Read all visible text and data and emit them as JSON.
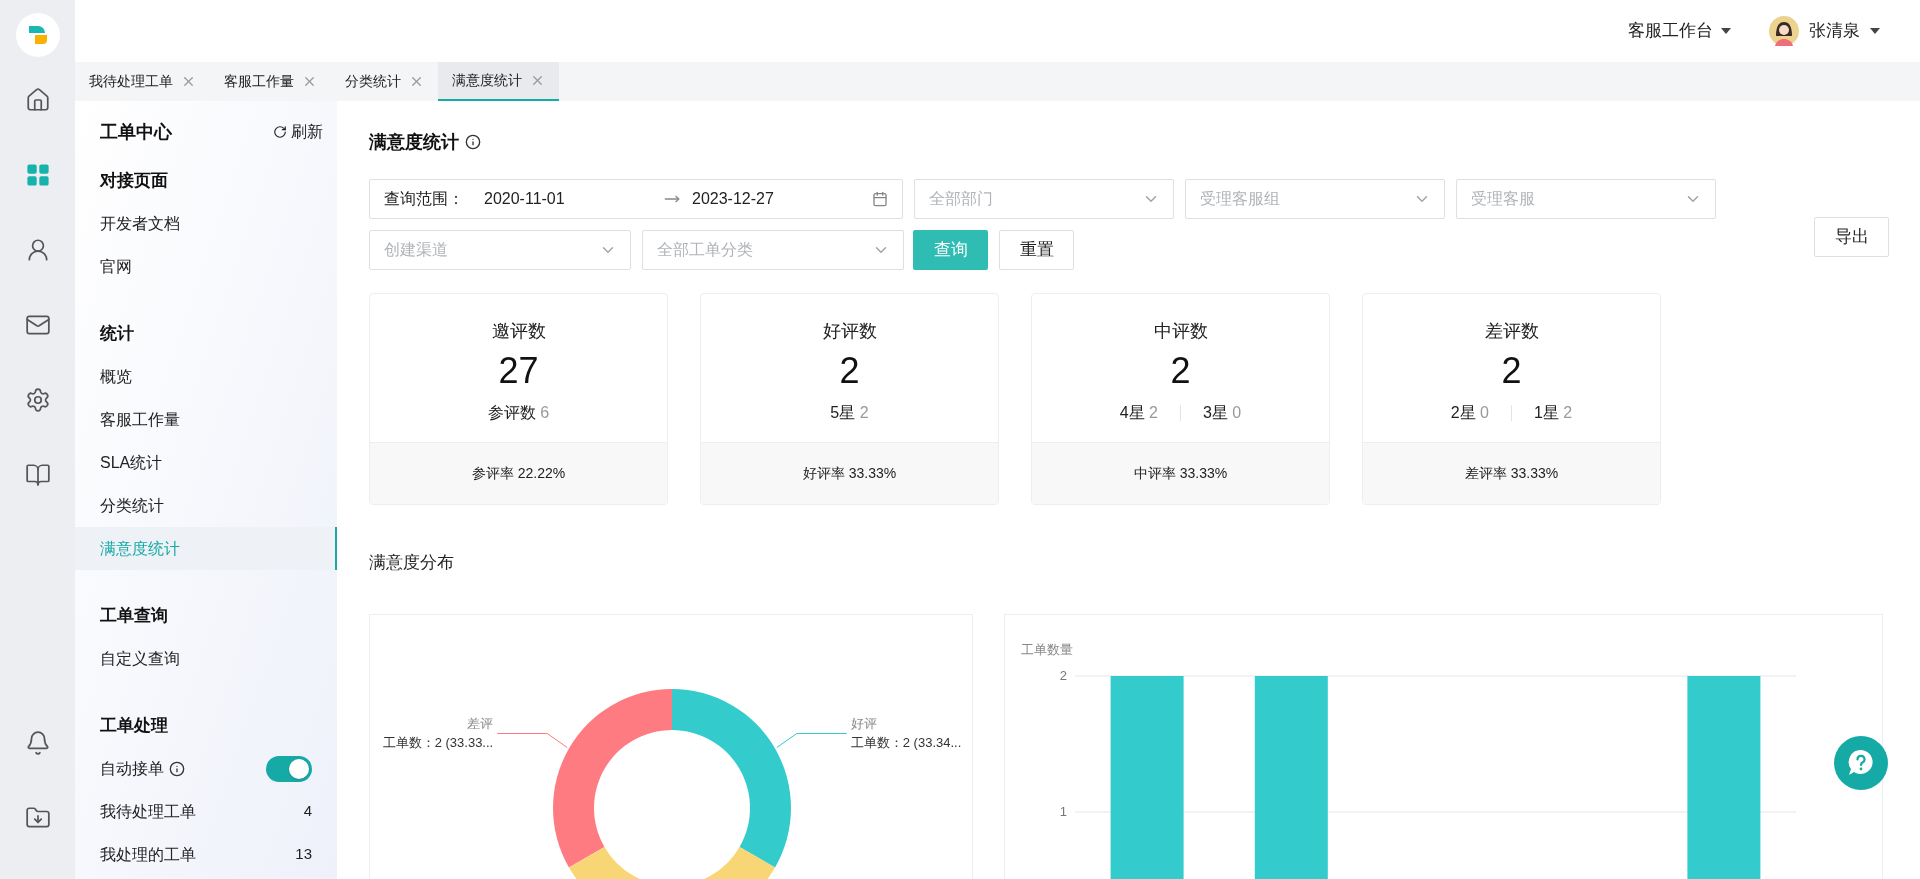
{
  "topbar": {
    "workspace": "客服工作台",
    "user": "张清泉"
  },
  "tabs": [
    {
      "label": "我待处理工单",
      "selected": false
    },
    {
      "label": "客服工作量",
      "selected": false
    },
    {
      "label": "分类统计",
      "selected": false
    },
    {
      "label": "满意度统计",
      "selected": true
    }
  ],
  "rail_top": [
    {
      "kind": "home",
      "selected": false
    },
    {
      "kind": "apps",
      "selected": true
    },
    {
      "kind": "agent",
      "selected": false
    },
    {
      "kind": "mail",
      "selected": false
    },
    {
      "kind": "settings",
      "selected": false
    },
    {
      "kind": "book",
      "selected": false
    }
  ],
  "rail_bottom": [
    {
      "kind": "bell",
      "selected": false
    },
    {
      "kind": "download",
      "selected": false
    }
  ],
  "sidebar": {
    "title": "工单中心",
    "refresh": "刷新",
    "groups": [
      {
        "title": "对接页面",
        "items": [
          {
            "kind": "link",
            "label": "开发者文档",
            "selected": false
          },
          {
            "kind": "link",
            "label": "官网",
            "selected": false
          }
        ]
      },
      {
        "title": "统计",
        "items": [
          {
            "kind": "link",
            "label": "概览",
            "selected": false
          },
          {
            "kind": "link",
            "label": "客服工作量",
            "selected": false
          },
          {
            "kind": "link",
            "label": "SLA统计",
            "selected": false
          },
          {
            "kind": "link",
            "label": "分类统计",
            "selected": false
          },
          {
            "kind": "link",
            "label": "满意度统计",
            "selected": true
          }
        ]
      },
      {
        "title": "工单查询",
        "items": [
          {
            "kind": "link",
            "label": "自定义查询",
            "selected": false
          }
        ]
      },
      {
        "title": "工单处理",
        "items": [
          {
            "kind": "toggle",
            "label": "自动接单",
            "on": true
          },
          {
            "kind": "count",
            "label": "我待处理工单",
            "count": "4",
            "selected": false
          },
          {
            "kind": "count",
            "label": "我处理的工单",
            "count": "13",
            "selected": false
          }
        ]
      }
    ]
  },
  "page": {
    "title": "满意度统计",
    "filters": {
      "range_label": "查询范围：",
      "start": "2020-11-01",
      "end": "2023-12-27",
      "row1_selects": [
        {
          "placeholder": "全部部门"
        },
        {
          "placeholder": "受理客服组"
        },
        {
          "placeholder": "受理客服"
        }
      ],
      "row2_selects": [
        {
          "placeholder": "创建渠道"
        },
        {
          "placeholder": "全部工单分类"
        }
      ],
      "query": "查询",
      "reset": "重置",
      "export": "导出"
    },
    "cards": [
      {
        "title": "邀评数",
        "value": "27",
        "breakdown": [
          {
            "label": "参评数",
            "value": "6"
          }
        ],
        "rate": "参评率 22.22%"
      },
      {
        "title": "好评数",
        "value": "2",
        "breakdown": [
          {
            "label": "5星",
            "value": "2"
          }
        ],
        "rate": "好评率 33.33%"
      },
      {
        "title": "中评数",
        "value": "2",
        "breakdown": [
          {
            "label": "4星",
            "value": "2"
          },
          {
            "label": "3星",
            "value": "0"
          }
        ],
        "rate": "中评率 33.33%"
      },
      {
        "title": "差评数",
        "value": "2",
        "breakdown": [
          {
            "label": "2星",
            "value": "0"
          },
          {
            "label": "1星",
            "value": "2"
          }
        ],
        "rate": "差评率 33.33%"
      }
    ],
    "distribution": {
      "title": "满意度分布",
      "donut": {
        "slices": [
          {
            "color": "#fe7c81",
            "label": "差评",
            "detail": "工单数：2 (33.33..."
          },
          {
            "color": "#33cbcc",
            "label": "好评",
            "detail": "工单数：2 (33.34..."
          },
          {
            "color": "#f8d676"
          }
        ]
      },
      "bar": {
        "chart_data": {
          "type": "bar",
          "ylabel": "工单数量",
          "ylim": [
            0,
            2
          ],
          "yticks": [
            1,
            2
          ],
          "series": [
            {
              "color": "#33cbcc",
              "values": [
                2,
                2,
                0,
                0,
                2
              ]
            }
          ]
        }
      }
    }
  }
}
